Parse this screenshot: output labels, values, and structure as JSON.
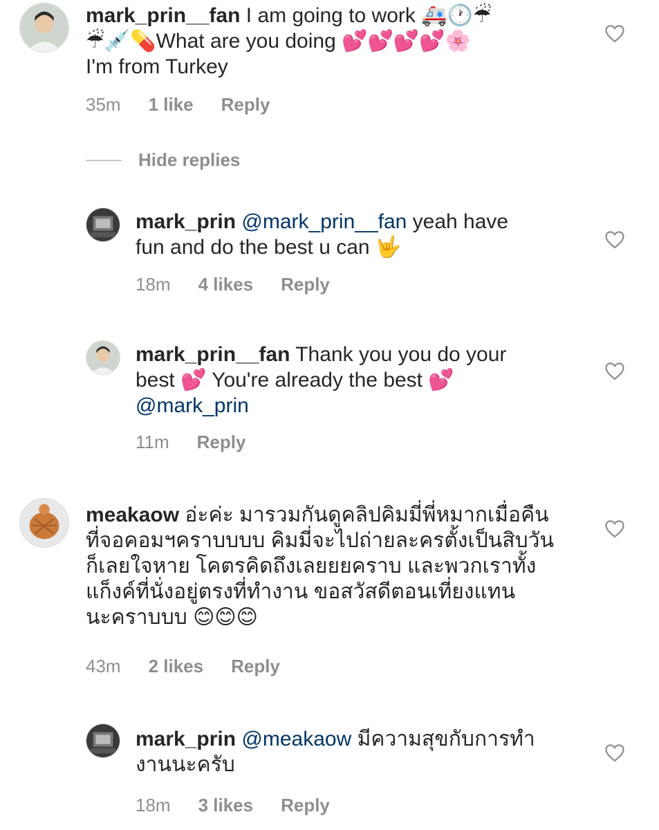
{
  "comments": [
    {
      "username": "mark_prin__fan",
      "text_line1": " I am going to work 🚑🕐☔",
      "text_line2": "☔💉💊What are you doing 💕💕💕💕🌸",
      "text_line3": "I'm from Turkey",
      "time": "35m",
      "likes": "1 like",
      "reply": "Reply"
    },
    {
      "username": "mark_prin",
      "mention": "@mark_prin__fan",
      "text_line1_rest": " yeah have",
      "text_line2": "fun and do the best u can 🤟",
      "time": "18m",
      "likes": "4 likes",
      "reply": "Reply"
    },
    {
      "username": "mark_prin__fan",
      "text_line1_rest": " Thank you you do your",
      "text_line2": "best 💕  You're already the best 💕",
      "mention": "@mark_prin",
      "time": "11m",
      "reply": "Reply"
    },
    {
      "username": "meakaow",
      "text_line1_rest": " อ่ะค่ะ มารวมกันดูคลิปคิมมี่พี่หมากเมื่อคืน",
      "text_line2": "ที่จอคอมฯคราบบบบ คิมมี่จะไปถ่ายละครตั้งเป็นสิบวัน",
      "text_line3": "ก็เลยใจหาย โคตรคิดถึงเลยยยคราบ และพวกเราทั้ง",
      "text_line4": "แก็งค์ที่นั่งอยู่ตรงที่ทำงาน ขอสวัสดีตอนเที่ยงแทน",
      "text_line5": "นะคราบบบ 😊😊😊",
      "time": "43m",
      "likes": "2 likes",
      "reply": "Reply"
    },
    {
      "username": "mark_prin",
      "mention": "@meakaow",
      "text_line1_rest": " มีความสุขกับการทำ",
      "text_line2": "งานนะครับ",
      "time": "18m",
      "likes": "3 likes",
      "reply": "Reply"
    }
  ],
  "hide_replies": "Hide replies",
  "icons": {
    "like": "heart-outline-icon"
  }
}
